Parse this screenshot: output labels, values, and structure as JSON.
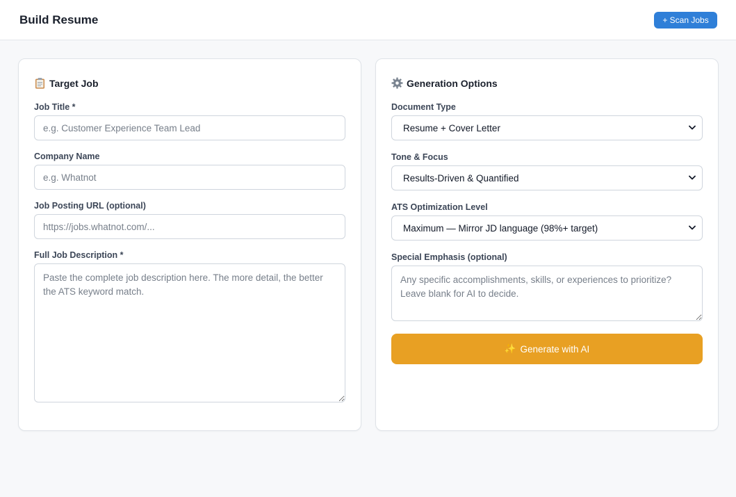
{
  "header": {
    "title": "Build Resume",
    "scan_button": "+ Scan Jobs"
  },
  "target_job": {
    "title": "Target Job",
    "icon": "clipboard-icon",
    "job_title_label": "Job Title *",
    "job_title_placeholder": "e.g. Customer Experience Team Lead",
    "company_label": "Company Name",
    "company_placeholder": "e.g. Whatnot",
    "url_label": "Job Posting URL (optional)",
    "url_placeholder": "https://jobs.whatnot.com/...",
    "description_label": "Full Job Description *",
    "description_placeholder": "Paste the complete job description here. The more detail, the better the ATS keyword match."
  },
  "generation_options": {
    "title": "Generation Options",
    "icon": "gear-icon",
    "document_type_label": "Document Type",
    "document_type_value": "Resume + Cover Letter",
    "tone_label": "Tone & Focus",
    "tone_value": "Results-Driven & Quantified",
    "ats_label": "ATS Optimization Level",
    "ats_value": "Maximum — Mirror JD language (98%+ target)",
    "emphasis_label": "Special Emphasis (optional)",
    "emphasis_placeholder": "Any specific accomplishments, skills, or experiences to prioritize? Leave blank for AI to decide.",
    "generate_button": "Generate with AI",
    "generate_icon": "sparkles-icon"
  },
  "colors": {
    "primary": "#2f7fd8",
    "accent": "#e8a023",
    "background": "#f7f8fa"
  }
}
